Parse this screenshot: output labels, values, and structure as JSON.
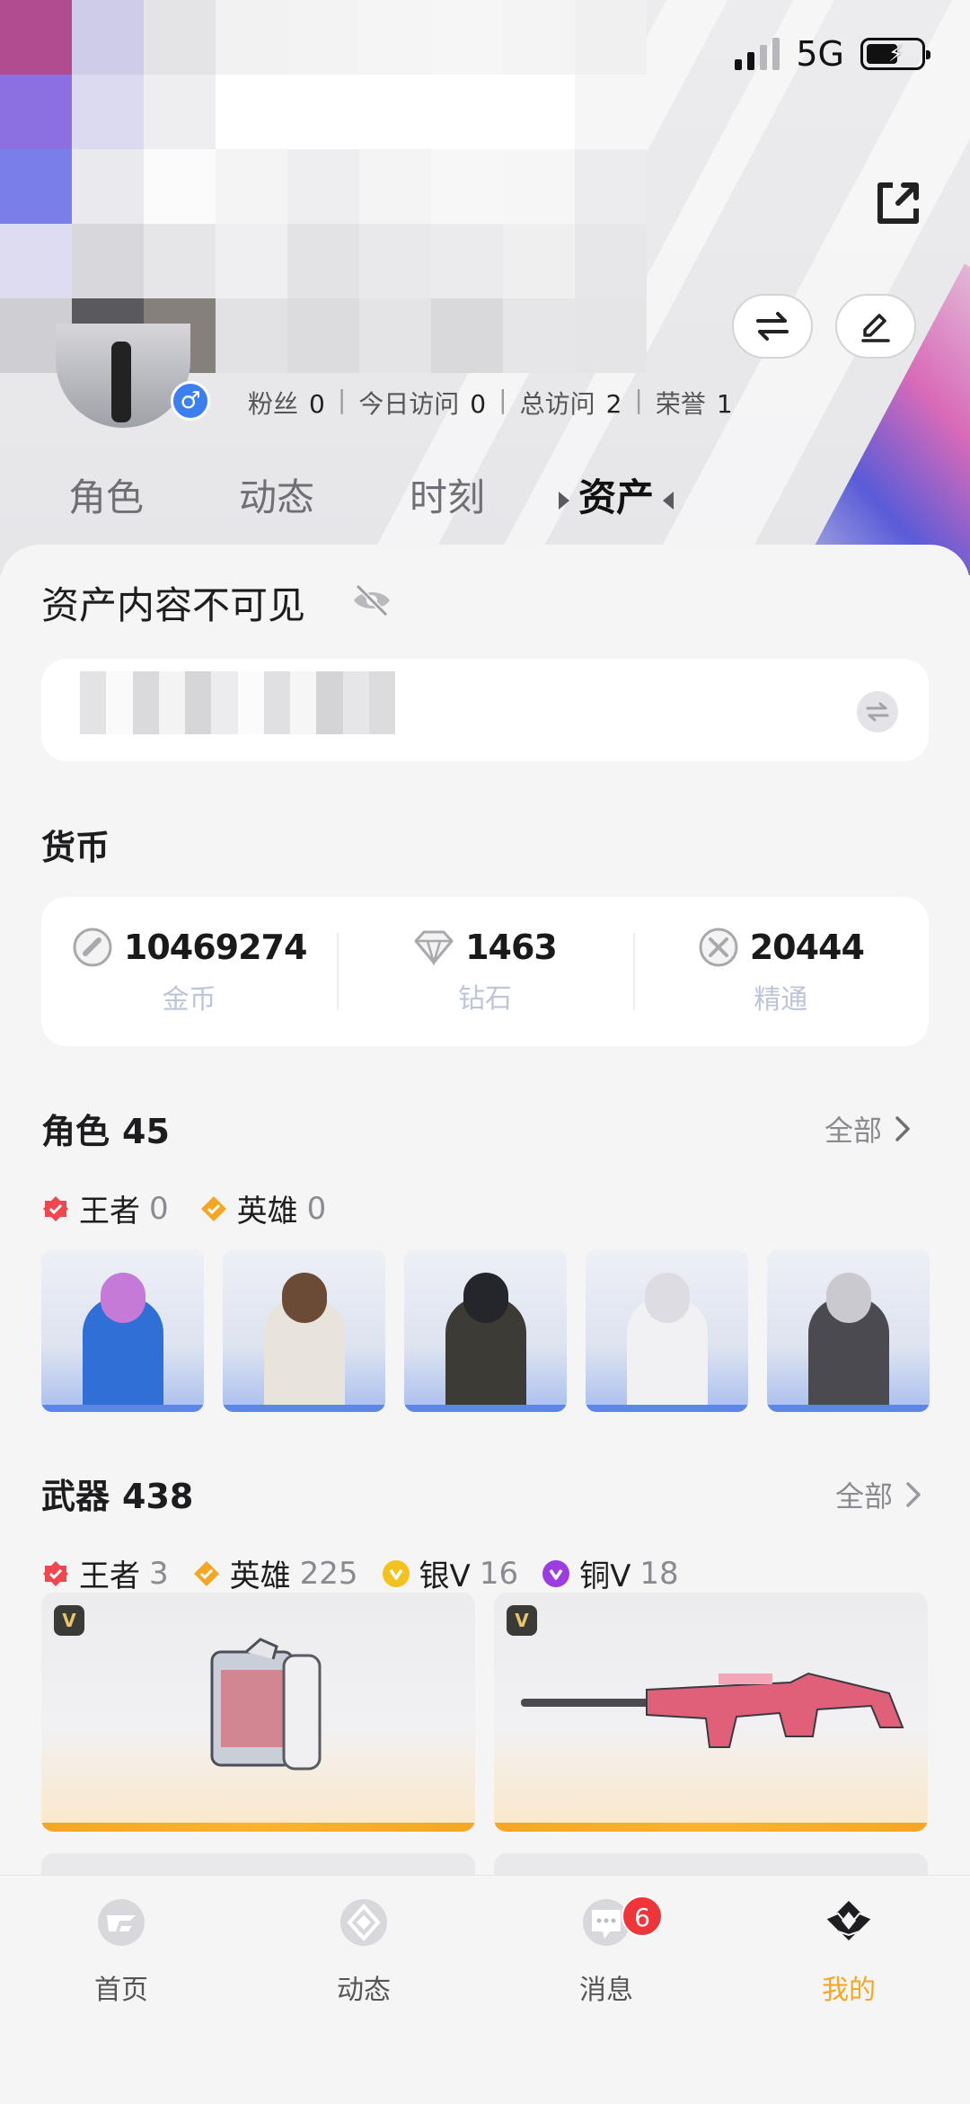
{
  "status_bar": {
    "network": "5G"
  },
  "profile": {
    "gender_icon": "male-icon",
    "stats": [
      {
        "label": "粉丝",
        "value": "0"
      },
      {
        "label": "今日访问",
        "value": "0"
      },
      {
        "label": "总访问",
        "value": "2"
      },
      {
        "label": "荣誉",
        "value": "1"
      }
    ]
  },
  "tabs": [
    "角色",
    "动态",
    "时刻",
    "资产"
  ],
  "active_tab": "资产",
  "assets": {
    "visibility_title": "资产内容不可见",
    "currency_title": "货币",
    "currencies": [
      {
        "icon": "gold-coin-icon",
        "value": "10469274",
        "name": "金币"
      },
      {
        "icon": "diamond-icon",
        "value": "1463",
        "name": "钻石"
      },
      {
        "icon": "mastery-icon",
        "value": "20444",
        "name": "精通"
      }
    ],
    "characters": {
      "title": "角色",
      "count": "45",
      "more": "全部",
      "rarities": [
        {
          "label": "王者",
          "count": "0",
          "color": "#f0474f"
        },
        {
          "label": "英雄",
          "count": "0",
          "color": "#f5a623"
        }
      ]
    },
    "weapons": {
      "title": "武器",
      "count": "438",
      "more": "全部",
      "rarities": [
        {
          "label": "王者",
          "count": "3",
          "color": "#f0474f"
        },
        {
          "label": "英雄",
          "count": "225",
          "color": "#f5a623"
        },
        {
          "label": "银V",
          "count": "16",
          "color": "#f2c31c"
        },
        {
          "label": "铜V",
          "count": "18",
          "color": "#9b3de0"
        }
      ],
      "badge": "V"
    }
  },
  "nav": {
    "items": [
      {
        "label": "首页",
        "icon": "home-icon"
      },
      {
        "label": "动态",
        "icon": "feed-icon"
      },
      {
        "label": "消息",
        "icon": "message-icon",
        "badge": "6"
      },
      {
        "label": "我的",
        "icon": "profile-icon",
        "active": true
      }
    ]
  },
  "colors": {
    "accent": "#f5a623",
    "badge": "#f0353a"
  }
}
